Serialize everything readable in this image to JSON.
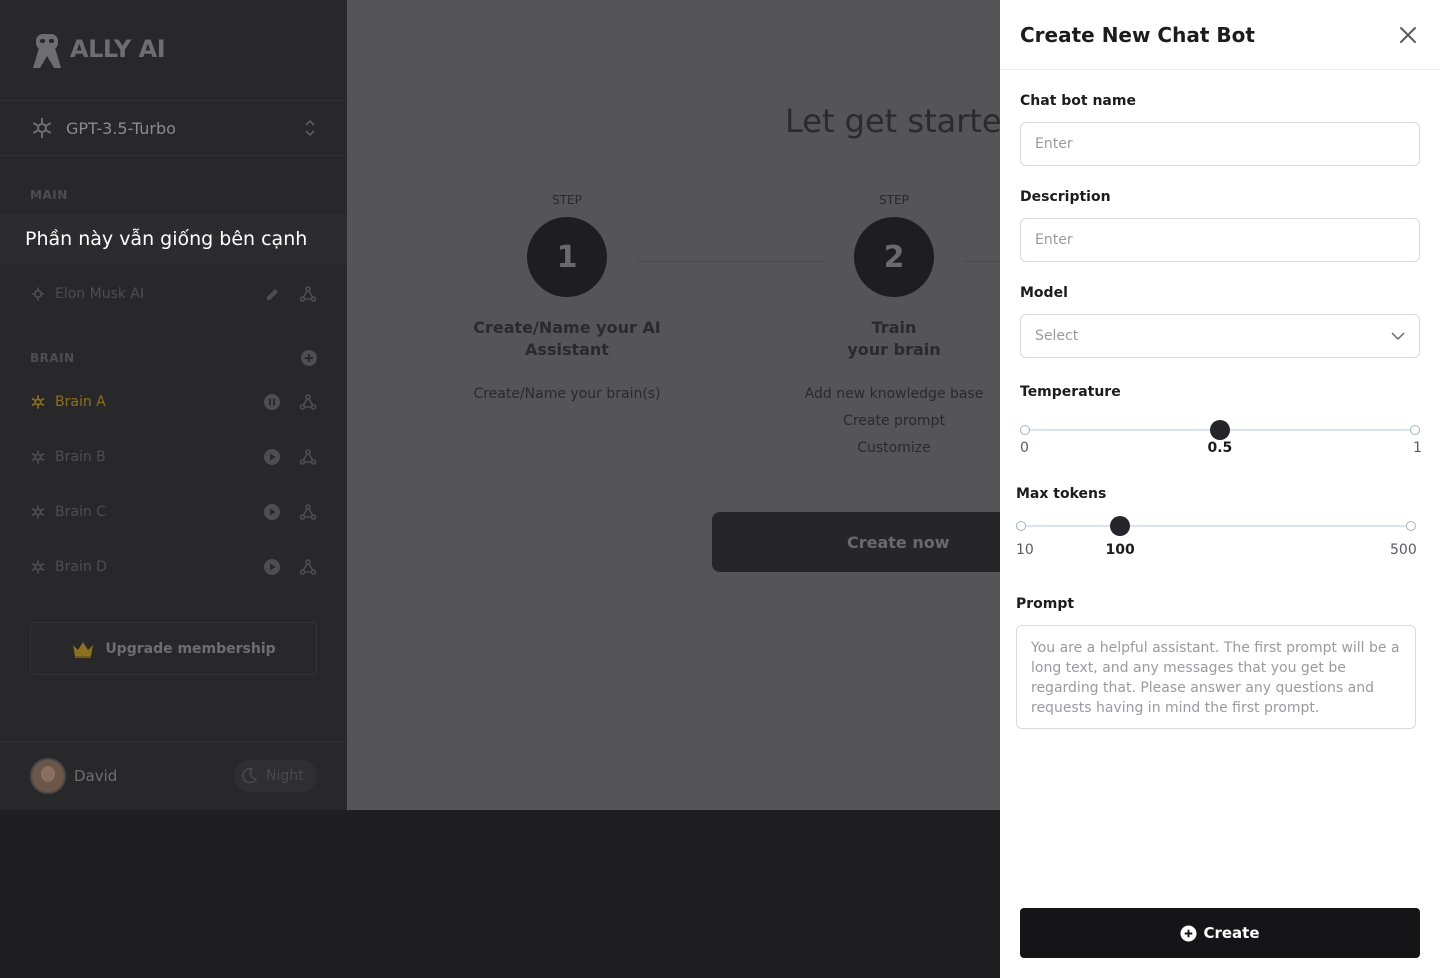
{
  "sidebar": {
    "brand": "ALLY AI",
    "model": "GPT-3.5-Turbo",
    "main_label": "MAIN",
    "note": "Phần này vẫn giống bên cạnh",
    "main_items": [
      {
        "label": "Elon Musk AI"
      }
    ],
    "brain_label": "BRAIN",
    "brains": [
      {
        "label": "Brain A",
        "state": "active"
      },
      {
        "label": "Brain B",
        "state": "idle"
      },
      {
        "label": "Brain C",
        "state": "idle"
      },
      {
        "label": "Brain D",
        "state": "idle"
      }
    ],
    "upgrade_label": "Upgrade membership",
    "user_name": "David",
    "theme_label": "Night"
  },
  "main": {
    "title": "Let get started",
    "steps": [
      {
        "label": "STEP",
        "number": "1",
        "title_line1": "Create/Name your AI",
        "title_line2": "Assistant",
        "desc": [
          "Create/Name your brain(s)"
        ]
      },
      {
        "label": "STEP",
        "number": "2",
        "title_line1": "Train",
        "title_line2": "your brain",
        "desc": [
          "Add new knowledge base",
          "Create prompt",
          "Customize"
        ]
      }
    ],
    "create_now": "Create now"
  },
  "drawer": {
    "title": "Create New Chat Bot",
    "name_label": "Chat bot name",
    "name_placeholder": "Enter",
    "desc_label": "Description",
    "desc_placeholder": "Enter",
    "model_label": "Model",
    "model_value": "Select",
    "temperature": {
      "label": "Temperature",
      "min": "0",
      "max": "1",
      "value": "0.5",
      "fraction": 0.5
    },
    "max_tokens": {
      "label": "Max tokens",
      "min": "10",
      "max": "500",
      "value": "100",
      "fraction": 0.26
    },
    "prompt_label": "Prompt",
    "prompt_placeholder": "You are a helpful assistant. The first prompt will be a long text, and any messages that you get be regarding that. Please answer any questions and requests having in mind the first prompt.",
    "create_label": "Create"
  }
}
